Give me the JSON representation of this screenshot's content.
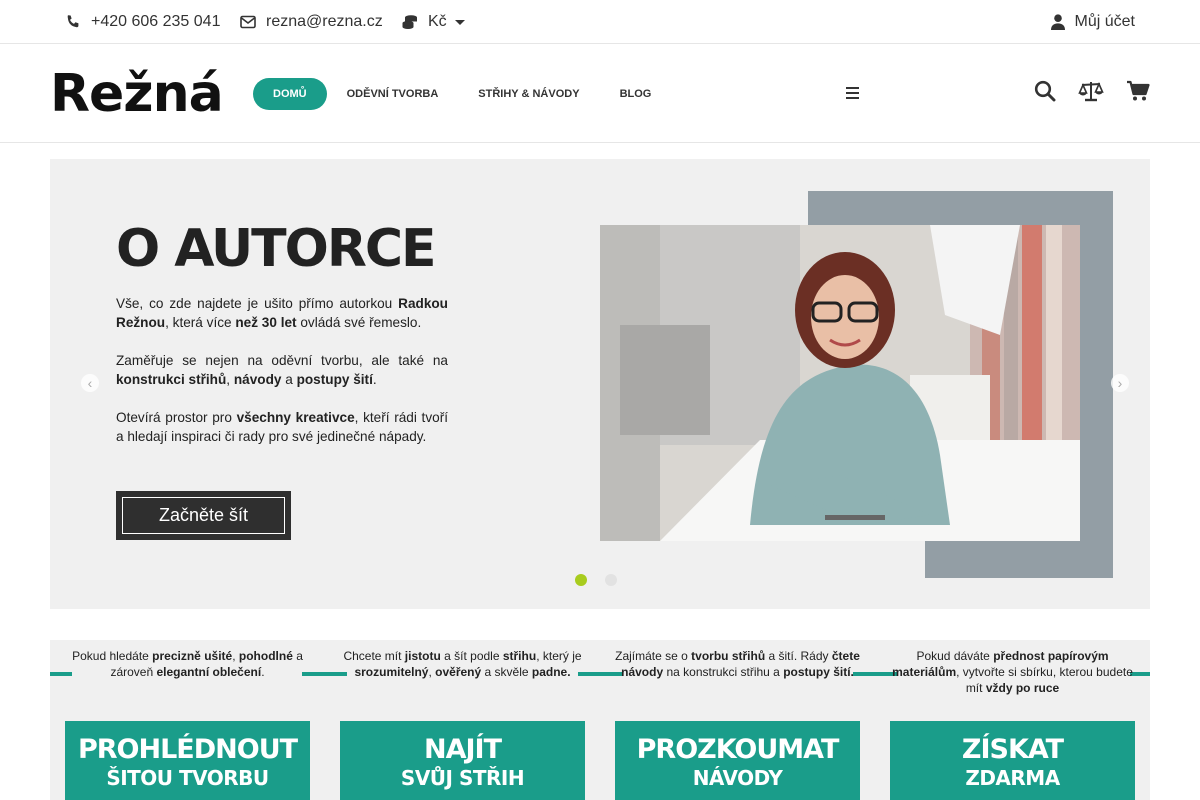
{
  "topbar": {
    "phone": "+420 606 235 041",
    "email": "rezna@rezna.cz",
    "currency": "Kč",
    "account": "Můj účet"
  },
  "header": {
    "logo": "Režná",
    "nav": [
      {
        "label": "DOMŮ",
        "active": true
      },
      {
        "label": "ODĚVNÍ TVORBA",
        "active": false
      },
      {
        "label": "STŘIHY & NÁVODY",
        "active": false
      },
      {
        "label": "BLOG",
        "active": false
      }
    ],
    "icons": [
      "search-icon",
      "compare-icon",
      "cart-icon"
    ]
  },
  "slider": {
    "title": "O AUTORCE",
    "p1_a": "Vše, co zde najdete je ušito přímo autorkou ",
    "p1_b": "Radkou Režnou",
    "p1_c": ", která více ",
    "p1_d": "než 30 let",
    "p1_e": " ovládá své řemeslo.",
    "p2_a": "Zaměřuje se nejen na oděvní tvorbu, ale také na ",
    "p2_b": "konstrukci střihů",
    "p2_c": ", ",
    "p2_d": "návody",
    "p2_e": " a ",
    "p2_f": "postupy šití",
    "p2_g": ".",
    "p3_a": "Otevírá prostor pro ",
    "p3_b": "všechny kreativce",
    "p3_c": ", kteří rádi tvoří a hledají inspiraci či rady pro své jedinečné nápady.",
    "cta": "Začněte šít",
    "prev": "‹",
    "next": "›",
    "slides_count": 2,
    "active_slide": 1
  },
  "promos": [
    {
      "text_html": "Pokud hledáte <b>precizně ušité</b>, <b>pohodlné</b> a zároveň <b>elegantní oblečení</b>.",
      "line1": "PROHLÉDNOUT",
      "line2": "ŠITOU TVORBU"
    },
    {
      "text_html": "Chcete mít <b>jistotu</b> a šít podle <b>střihu</b>, který je <b>srozumitelný</b>, <b>ověřený</b> a skvěle <b>padne.</b>",
      "line1": "NAJÍT",
      "line2": "SVŮJ STŘIH"
    },
    {
      "text_html": "Zajímáte se o <b>tvorbu střihů</b> a šití. Rády <b>čtete návody</b> na konstrukci střihu a <b>postupy šití.</b>",
      "line1": "PROZKOUMAT",
      "line2": "NÁVODY"
    },
    {
      "text_html": "Pokud dáváte <b>přednost papírovým materiálům</b>, vytvořte si sbírku, kterou budete mít <b>vždy po ruce</b>",
      "line1": "ZÍSKAT",
      "line2": "ZDARMA"
    }
  ],
  "colors": {
    "accent": "#1a9d8a",
    "dot_active": "#a8cc1e",
    "slider_bg": "#f0f0f0",
    "photo_frame": "#939ea5"
  }
}
